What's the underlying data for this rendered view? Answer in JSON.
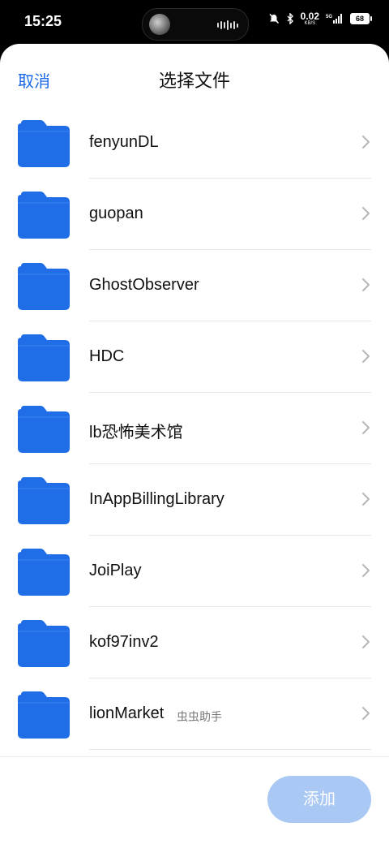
{
  "status_bar": {
    "time": "15:25",
    "net_speed": "0.02",
    "net_unit": "KB/S",
    "network": "5G",
    "battery": "68"
  },
  "header": {
    "cancel_label": "取消",
    "title": "选择文件"
  },
  "files": [
    {
      "name": "fenyunDL",
      "tag": ""
    },
    {
      "name": "guopan",
      "tag": ""
    },
    {
      "name": "GhostObserver",
      "tag": ""
    },
    {
      "name": "HDC",
      "tag": ""
    },
    {
      "name": "lb恐怖美术馆",
      "tag": ""
    },
    {
      "name": "InAppBillingLibrary",
      "tag": ""
    },
    {
      "name": "JoiPlay",
      "tag": ""
    },
    {
      "name": "kof97inv2",
      "tag": ""
    },
    {
      "name": "lionMarket",
      "tag": "虫虫助手"
    }
  ],
  "footer": {
    "add_label": "添加"
  },
  "colors": {
    "accent": "#1a6ae6",
    "folder": "#1f6ee8",
    "add_disabled": "#aac8f4"
  }
}
